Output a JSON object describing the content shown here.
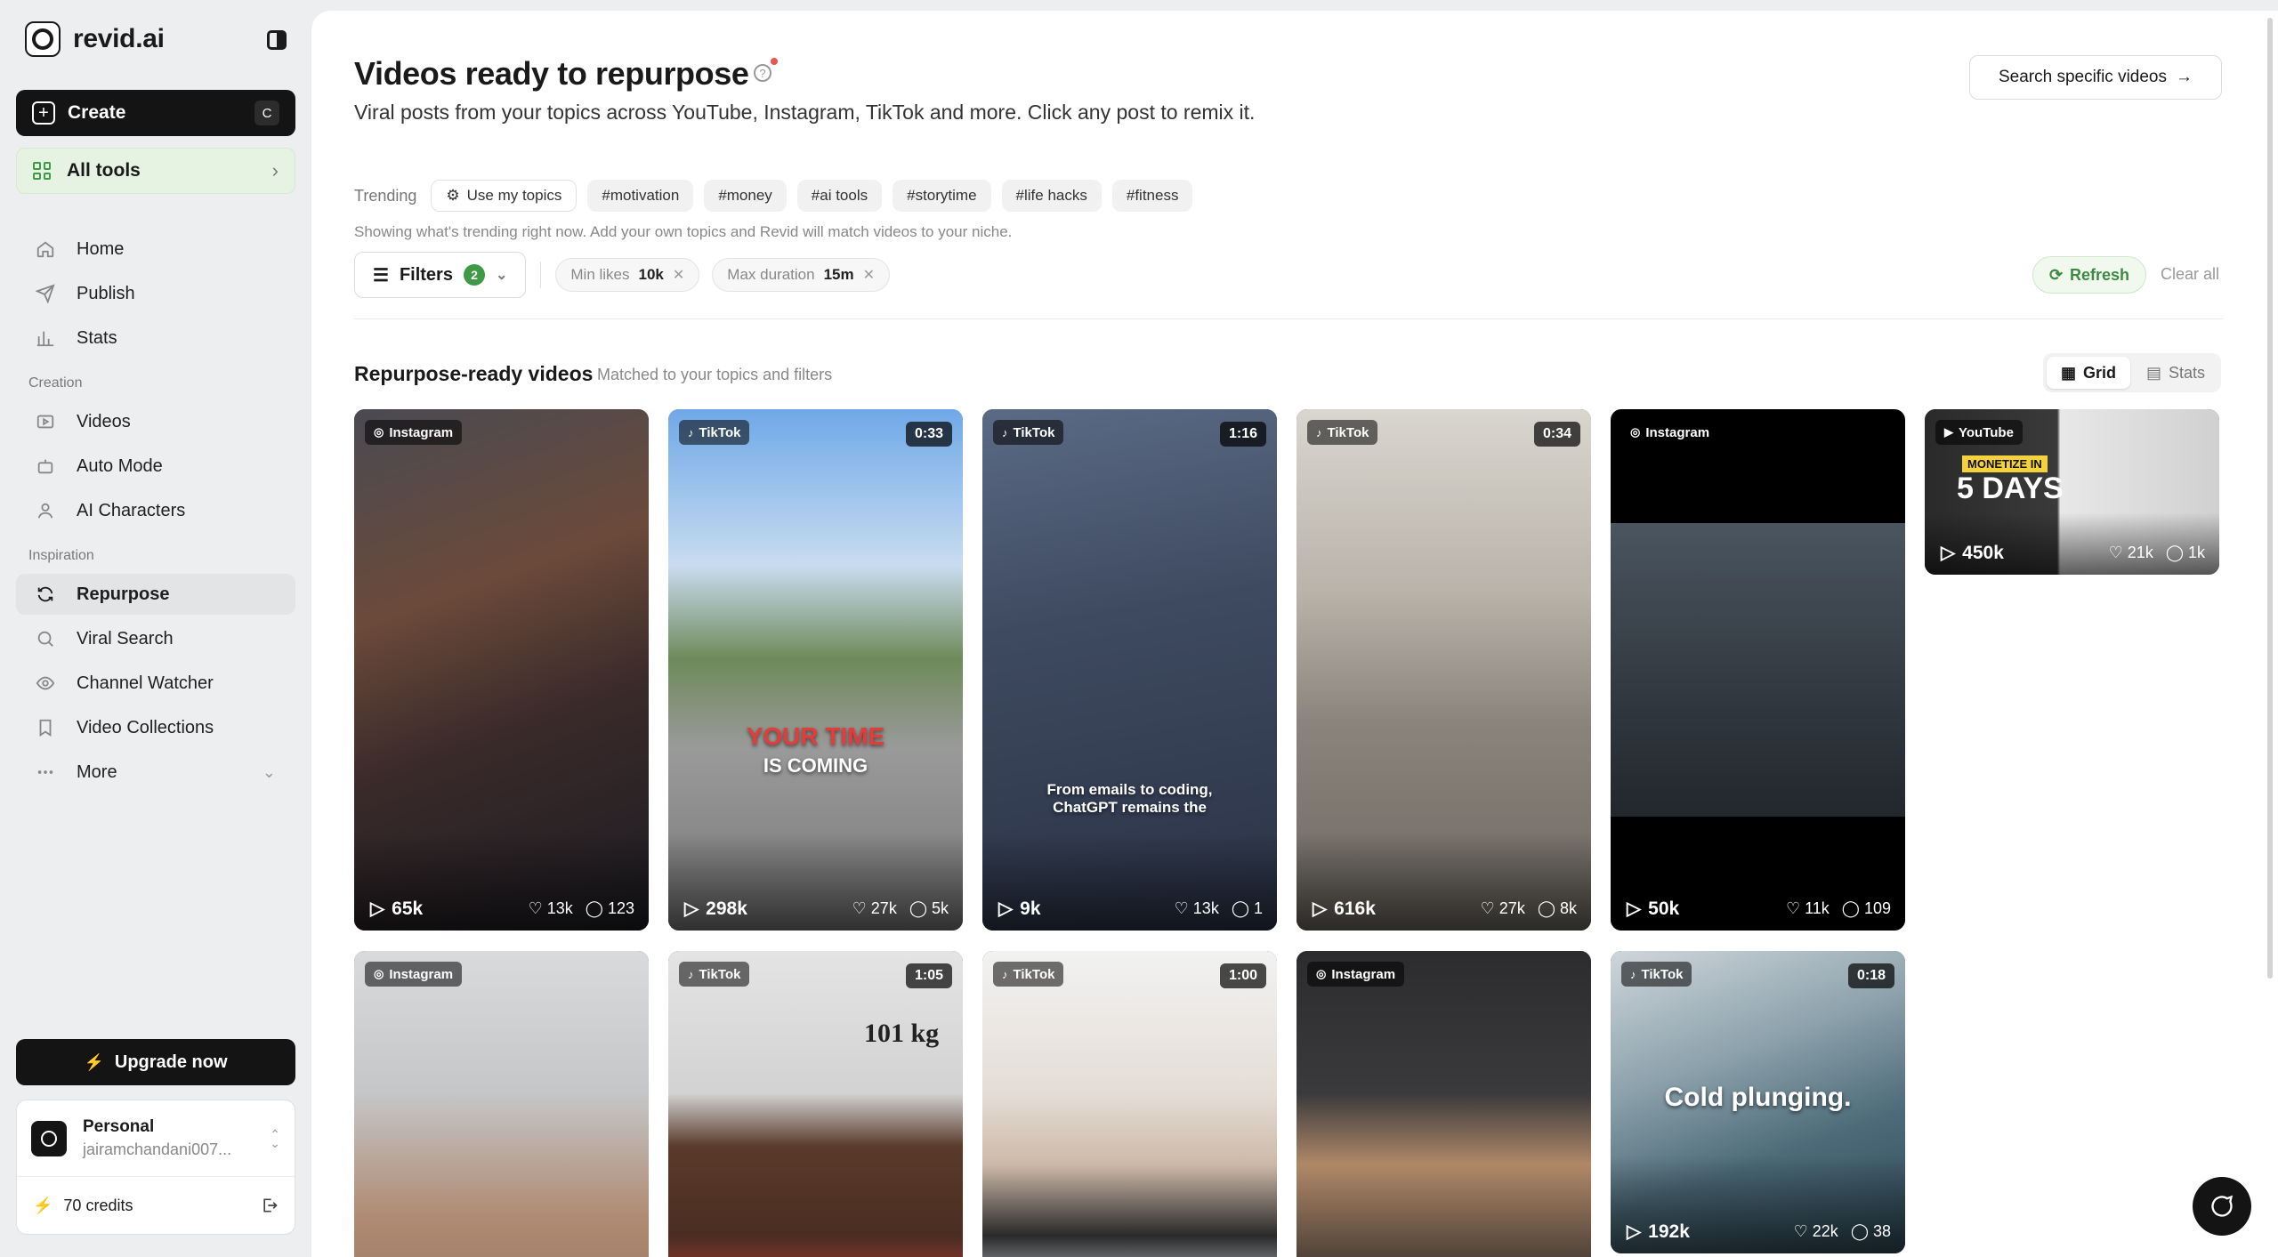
{
  "sidebar": {
    "brand": "revid.ai",
    "create_label": "Create",
    "create_shortcut": "C",
    "all_tools_label": "All tools",
    "nav_main": [
      {
        "label": "Home",
        "icon": "home-icon"
      },
      {
        "label": "Publish",
        "icon": "send-icon"
      },
      {
        "label": "Stats",
        "icon": "bar-chart-icon"
      }
    ],
    "section_creation": "Creation",
    "nav_creation": [
      {
        "label": "Videos",
        "icon": "video-icon"
      },
      {
        "label": "Auto Mode",
        "icon": "robot-icon"
      },
      {
        "label": "AI Characters",
        "icon": "user-icon"
      }
    ],
    "section_inspiration": "Inspiration",
    "nav_inspiration": [
      {
        "label": "Repurpose",
        "icon": "refresh-icon",
        "active": true
      },
      {
        "label": "Viral Search",
        "icon": "search-icon"
      },
      {
        "label": "Channel Watcher",
        "icon": "eye-icon"
      },
      {
        "label": "Video Collections",
        "icon": "bookmark-icon"
      },
      {
        "label": "More",
        "icon": "dots-icon"
      }
    ],
    "upgrade_label": "Upgrade now",
    "account": {
      "name": "Personal",
      "email": "jairamchandani007...",
      "credits": "70 credits"
    }
  },
  "header": {
    "title": "Videos ready to repurpose",
    "subtitle": "Viral posts from your topics across YouTube, Instagram, TikTok and more. Click any post to remix it.",
    "search_button": "Search specific videos"
  },
  "trending": {
    "label": "Trending",
    "use_topics": "Use my topics",
    "tags": [
      "#motivation",
      "#money",
      "#ai tools",
      "#storytime",
      "#life hacks",
      "#fitness"
    ],
    "note": "Showing what's trending right now. Add your own topics and Revid will match videos to your niche."
  },
  "filters": {
    "label": "Filters",
    "count": "2",
    "min_likes_label": "Min likes",
    "min_likes_value": "10k",
    "max_duration_label": "Max duration",
    "max_duration_value": "15m",
    "refresh_label": "Refresh",
    "clear_label": "Clear all"
  },
  "results": {
    "title": "Repurpose-ready videos",
    "subtitle": "Matched to your topics and filters",
    "view_grid": "Grid",
    "view_stats": "Stats"
  },
  "videos": [
    {
      "platform": "Instagram",
      "duration": "",
      "views": "65k",
      "likes": "13k",
      "comments": "123"
    },
    {
      "platform": "TikTok",
      "duration": "0:33",
      "views": "298k",
      "likes": "27k",
      "comments": "5k",
      "caption_a": "YOUR TIME",
      "caption_b": "IS COMING"
    },
    {
      "platform": "TikTok",
      "duration": "1:16",
      "views": "9k",
      "likes": "13k",
      "comments": "1",
      "caption_a": "From emails to coding,",
      "caption_b": "ChatGPT remains the"
    },
    {
      "platform": "TikTok",
      "duration": "0:34",
      "views": "616k",
      "likes": "27k",
      "comments": "8k"
    },
    {
      "platform": "Instagram",
      "duration": "",
      "views": "50k",
      "likes": "11k",
      "comments": "109"
    },
    {
      "platform": "YouTube",
      "duration": "",
      "views": "450k",
      "likes": "21k",
      "comments": "1k",
      "caption_a": "MONETIZE IN",
      "caption_b": "5 DAYS"
    },
    {
      "platform": "Instagram",
      "duration": ""
    },
    {
      "platform": "TikTok",
      "duration": "1:05",
      "caption_a": "101 kg"
    },
    {
      "platform": "TikTok",
      "duration": "1:00"
    },
    {
      "platform": "Instagram",
      "duration": ""
    },
    {
      "platform": "TikTok",
      "duration": "0:18",
      "views": "192k",
      "likes": "22k",
      "comments": "38",
      "caption_a": "Cold plunging."
    }
  ]
}
